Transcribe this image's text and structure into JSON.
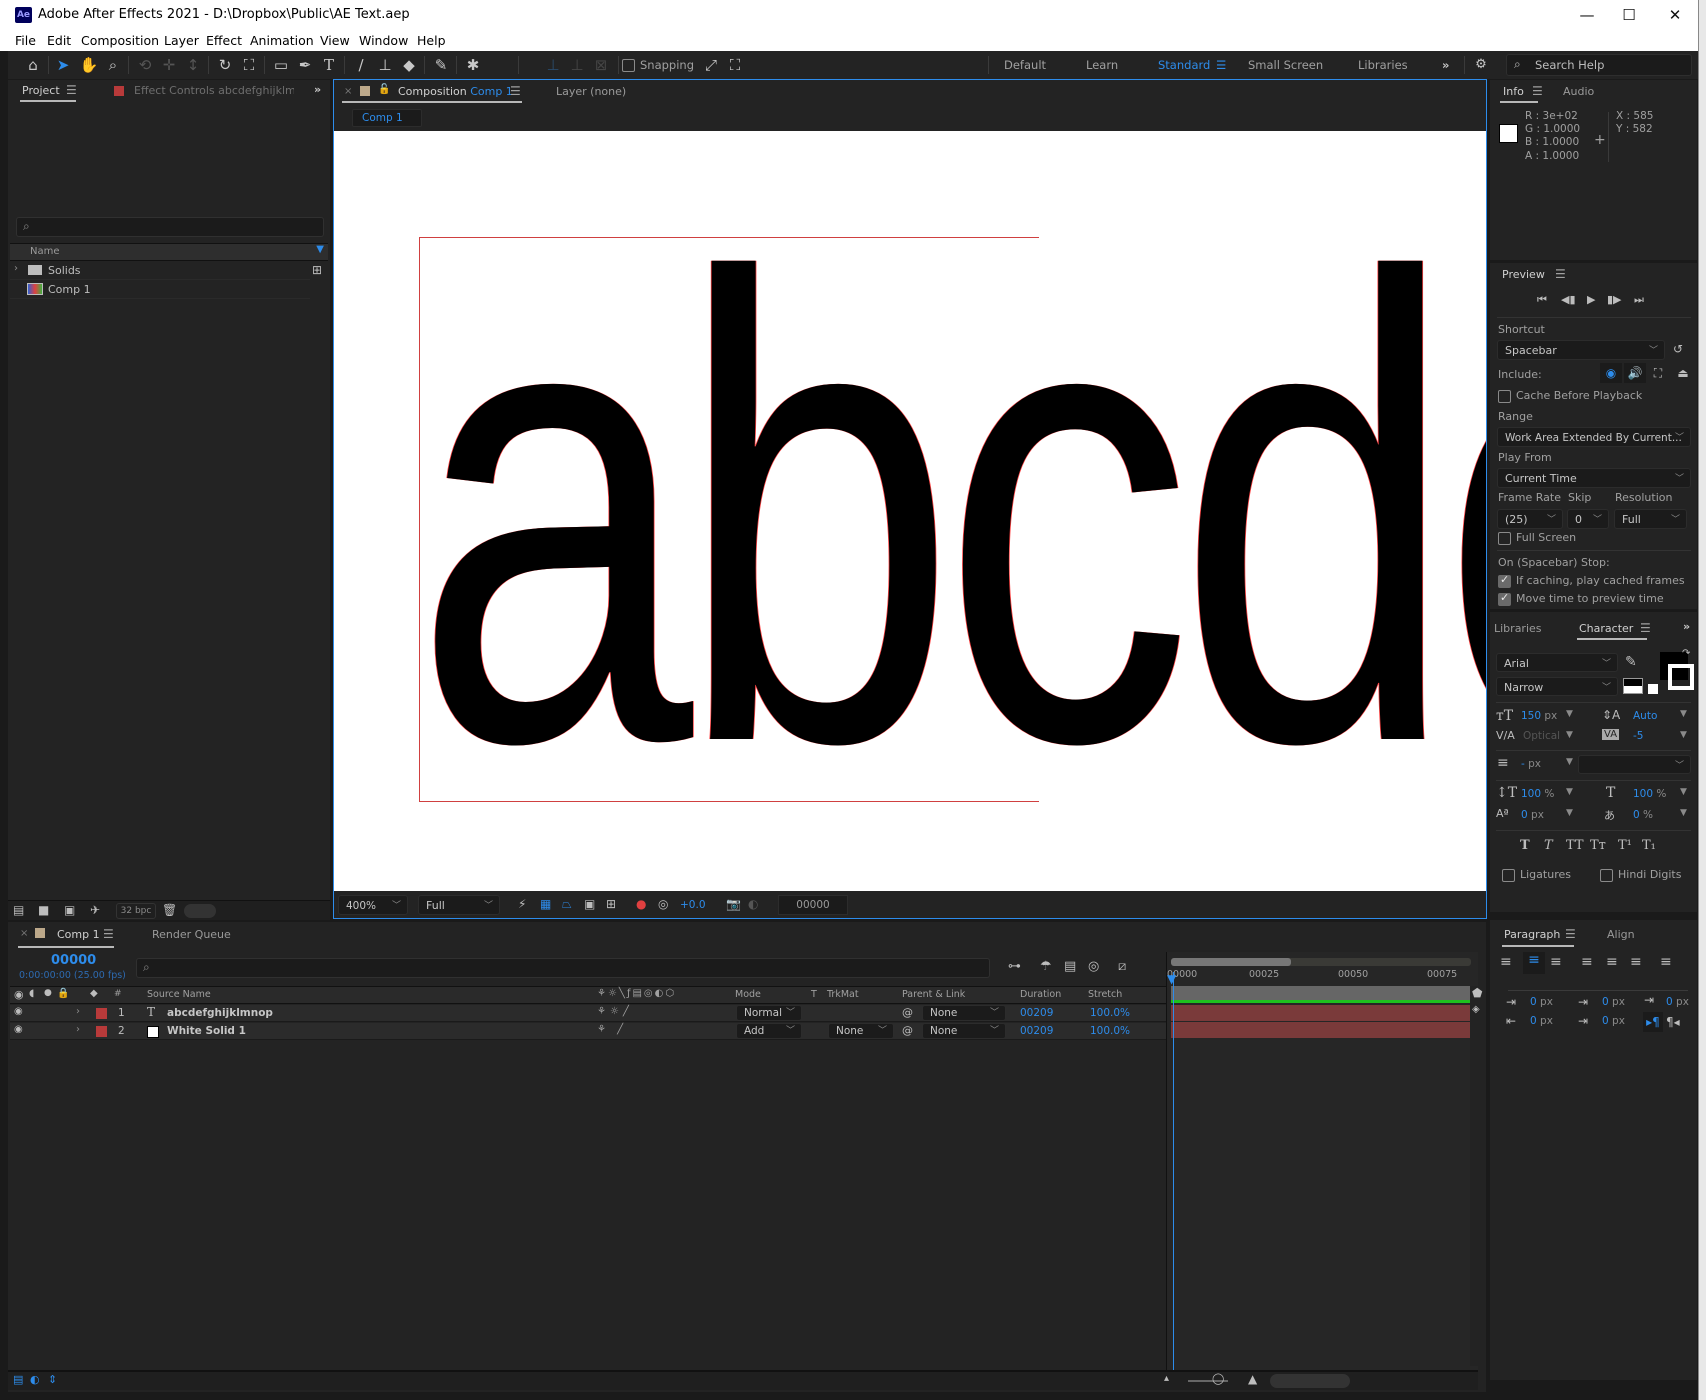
{
  "window": {
    "title": "Adobe After Effects 2021 - D:\\Dropbox\\Public\\AE Text.aep",
    "app_badge": "Ae",
    "minimize": "—",
    "maximize": "☐",
    "close": "✕"
  },
  "menu": [
    "File",
    "Edit",
    "Composition",
    "Layer",
    "Effect",
    "Animation",
    "View",
    "Window",
    "Help"
  ],
  "toolbar": {
    "snapping_label": "Snapping",
    "snapping_checked": false,
    "workspaces": [
      "Default",
      "Learn",
      "Standard",
      "Small Screen",
      "Libraries"
    ],
    "active_workspace": "Standard",
    "more": "»",
    "search_placeholder": "Search Help"
  },
  "project_panel": {
    "tab_project": "Project",
    "tab_effect_controls": "Effect Controls abcdefghijklmno",
    "more": "»",
    "column_name": "Name",
    "items": [
      {
        "name": "Solids",
        "type": "folder"
      },
      {
        "name": "Comp 1",
        "type": "composition"
      }
    ],
    "bpc": "32 bpc"
  },
  "comp_panel": {
    "tab_prefix": "Composition",
    "tab_comp": "Comp 1",
    "tab_layer": "Layer (none)",
    "breadcrumb": "Comp 1",
    "canvas_text": "abcde",
    "zoom": "400%",
    "resolution": "Full",
    "exposure": "+0.0",
    "timecode": "00000"
  },
  "info_panel": {
    "tab_info": "Info",
    "tab_audio": "Audio",
    "r": "R :  3e+02",
    "g": "G :  1.0000",
    "b": "B :  1.0000",
    "a": "A :  1.0000",
    "x": "X :  585",
    "y": "Y :  582",
    "swatch_color": "#ffffff"
  },
  "preview_panel": {
    "title": "Preview",
    "shortcut_label": "Shortcut",
    "shortcut_value": "Spacebar",
    "include_label": "Include:",
    "cache_before_playback": "Cache Before Playback",
    "range_label": "Range",
    "range_value": "Work Area Extended By Current...",
    "play_from_label": "Play From",
    "play_from_value": "Current Time",
    "frame_rate_label": "Frame Rate",
    "frame_rate_value": "(25)",
    "skip_label": "Skip",
    "skip_value": "0",
    "resolution_label": "Resolution",
    "resolution_value": "Full",
    "full_screen": "Full Screen",
    "on_stop_label": "On (Spacebar) Stop:",
    "if_caching": "If caching, play cached frames",
    "move_time": "Move time to preview time"
  },
  "character_panel": {
    "tab_libraries": "Libraries",
    "tab_character": "Character",
    "font_family": "Arial",
    "font_style": "Narrow",
    "font_size": "150",
    "leading": "Auto",
    "kerning": "Optical",
    "tracking": "-5",
    "stroke_width": "-",
    "vert_scale": "100",
    "horiz_scale": "100",
    "baseline_shift": "0",
    "tsume": "0",
    "unit_px": "px",
    "unit_pct": "%",
    "ligatures": "Ligatures",
    "hindi_digits": "Hindi Digits",
    "fill_color": "#000000"
  },
  "paragraph_panel": {
    "tab_paragraph": "Paragraph",
    "tab_align": "Align",
    "indent_left": "0",
    "indent_right": "0",
    "indent_first": "0",
    "space_before": "0",
    "space_after": "0",
    "unit": "px"
  },
  "timeline": {
    "tab_comp": "Comp 1",
    "tab_render_queue": "Render Queue",
    "current_frame": "00000",
    "timecode_detail": "0:00:00:00 (25.00 fps)",
    "columns": {
      "num": "#",
      "source_name": "Source Name",
      "mode": "Mode",
      "t": "T",
      "trkmat": "TrkMat",
      "parent": "Parent & Link",
      "duration": "Duration",
      "stretch": "Stretch"
    },
    "ruler": [
      "00000",
      "00025",
      "00050",
      "00075"
    ],
    "layers": [
      {
        "num": "1",
        "name": "abcdefghijklmnop",
        "type": "text",
        "mode": "Normal",
        "trkmat": "",
        "parent": "None",
        "duration": "00209",
        "stretch": "100.0%",
        "label_color": "#b83a3a"
      },
      {
        "num": "2",
        "name": "White Solid 1",
        "type": "solid",
        "mode": "Add",
        "trkmat": "None",
        "parent": "None",
        "duration": "00209",
        "stretch": "100.0%",
        "label_color": "#b83a3a"
      }
    ]
  }
}
